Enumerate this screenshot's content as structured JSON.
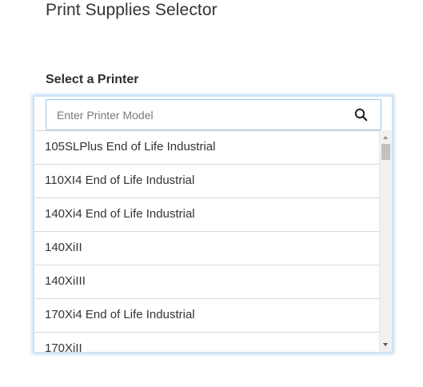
{
  "page": {
    "title": "Print Supplies Selector"
  },
  "selector": {
    "label": "Select a Printer",
    "search": {
      "placeholder": "Enter Printer Model",
      "value": "",
      "icon": "search-icon"
    },
    "options": [
      "105SLPlus End of Life Industrial",
      "110XI4 End of Life Industrial",
      "140Xi4 End of Life Industrial",
      "140XiII",
      "140XiIII",
      "170Xi4 End of Life Industrial",
      "170XiII"
    ],
    "colors": {
      "focus_border": "#9cc4e6",
      "focus_glow": "#aacdeb",
      "divider": "#d8d8d8",
      "text": "#333333"
    }
  }
}
